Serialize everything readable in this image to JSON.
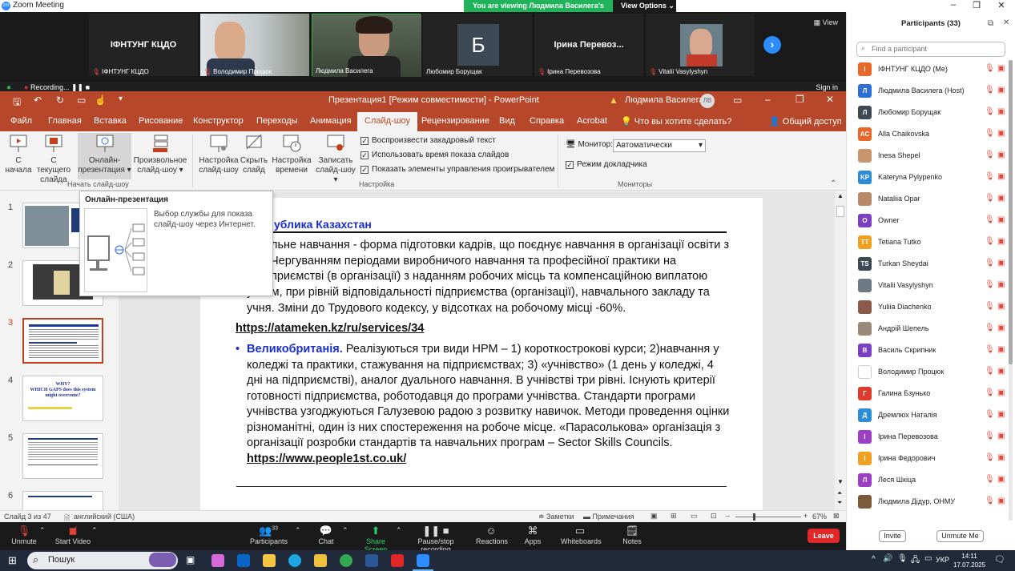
{
  "zoom_window": {
    "title": "Zoom Meeting",
    "banner": "You are viewing Людмила Василега's screen",
    "view_options": "View Options",
    "view_label": "View",
    "recording_label": "Recording...",
    "sign_in": "Sign in"
  },
  "video_tiles": [
    {
      "name": "ІФНТУНГ КЦДО",
      "display": "ІФНТУНГ КЦДО"
    },
    {
      "name": "Володимир Процюк",
      "display": ""
    },
    {
      "name": "Людмила Василега",
      "display": ""
    },
    {
      "name": "Любомир Борущак",
      "display": "Б"
    },
    {
      "name": "Ірина Перевозова",
      "display": "Ірина  Перевоз..."
    },
    {
      "name": "Vitalii Vasylyshyn",
      "display": ""
    }
  ],
  "ppt": {
    "title": "Презентация1 [Режим совместимости] - PowerPoint",
    "user": "Людмила Василега",
    "initials": "ЛВ",
    "tabs": [
      "Файл",
      "Главная",
      "Вставка",
      "Рисование",
      "Конструктор",
      "Переходы",
      "Анимация",
      "Слайд-шоу",
      "Рецензирование",
      "Вид",
      "Справка",
      "Acrobat"
    ],
    "tell_me": "Что вы хотите сделать?",
    "share": "Общий доступ",
    "ribbon": {
      "from_start": [
        "С",
        "начала"
      ],
      "from_current": [
        "С текущего",
        "слайда"
      ],
      "online": [
        "Онлайн-",
        "презентация"
      ],
      "custom": [
        "Произвольное",
        "слайд-шоу"
      ],
      "setup": [
        "Настройка",
        "слайд-шоу"
      ],
      "hide": [
        "Скрыть",
        "слайд"
      ],
      "timings": [
        "Настройка",
        "времени"
      ],
      "record": [
        "Записать",
        "слайд-шоу"
      ],
      "chk_narration": "Воспроизвести закадровый текст",
      "chk_timings": "Использовать время показа слайдов",
      "chk_controls": "Показать элементы управления проигрывателем",
      "monitor_label": "Монитор:",
      "monitor_value": "Автоматически",
      "presenter_view": "Режим докладчика",
      "group_start": "Начать слайд-шоу",
      "group_setup": "Настройка",
      "group_monitors": "Мониторы"
    },
    "tooltip": {
      "title": "Онлайн-презентация",
      "desc": "Выбор службы для показа слайд-шоу через Интернет."
    },
    "thumb_numbers": [
      "1",
      "2",
      "3",
      "4",
      "5",
      "6"
    ],
    "thumb4_text": [
      "WHY?",
      "WHICH GAPS does this system",
      "might   overcome?"
    ],
    "slide": {
      "heading_partial": "ублика Казахстан",
      "para1": [
        "льне навчання - форма підготовки кадрів, що поєднує навчання в організації освіти з",
        "Чергуванням періодами виробничого навчання та професійної практики на",
        "приємствi (в організації) з наданням робочих місць та компенсаційною виплатою",
        "учням, при рівній відповідальності підприємства (організації), навчального закладу та",
        "учня. Зміни до Трудового кодексу, у відсотках на робочому місці -60%."
      ],
      "link1": " https://atameken.kz/ru/services/34",
      "uk_label": "Великобританія.",
      "para2_first": " Реалізуються три види НРМ – 1) короткострокові курси; 2)навчання у",
      "para2": [
        "коледжі та практики, стажування на підприємствах; 3) «учнівство» (1 день у коледжі, 4",
        "дні на підприємстві), аналог дуального навчання. В учнівстві три рівні. Існують критерії",
        "готовності підприємства, роботодавця до програми учнівства. Стандарти програми",
        "учнівства узгоджуються Галузевою радою з розвитку навичок. Методи проведення оцінки",
        "різноманітні, один із них спостереження на робоче місце. «Парасолькова» організація з",
        "організації розробки стандартів та навчальних програм – Sector Skills Councils."
      ],
      "link2": "https://www.people1st.co.uk/"
    },
    "status": {
      "slide": "Слайд 3 из 47",
      "language": "английский (США)",
      "notes": "Заметки",
      "comments": "Примечания",
      "zoom": "67%"
    }
  },
  "zoom_toolbar": {
    "unmute": "Unmute",
    "start_video": "Start Video",
    "participants": "Participants",
    "participants_count": "33",
    "chat": "Chat",
    "share": "Share Screen",
    "pause_rec": "Pause/stop recording",
    "reactions": "Reactions",
    "apps": "Apps",
    "whiteboards": "Whiteboards",
    "notes": "Notes",
    "leave": "Leave"
  },
  "participants_panel": {
    "title": "Participants (33)",
    "search_placeholder": "Find a participant",
    "invite": "Invite",
    "unmute_me": "Unmute Me",
    "list": [
      {
        "name": "ІФНТУНГ КЦДО (Me)",
        "initial": "І",
        "color": "#e8682a"
      },
      {
        "name": "Людмила Василега (Host)",
        "initial": "Л",
        "color": "#2d6fd6"
      },
      {
        "name": "Любомир Борущак",
        "initial": "Л",
        "color": "#3d4a55"
      },
      {
        "name": "Alla Chaikovska",
        "initial": "AC",
        "color": "#e8682a"
      },
      {
        "name": "Inesa Shepel",
        "initial": "",
        "color": "#c9956b"
      },
      {
        "name": "Kateryna Pylypenko",
        "initial": "KP",
        "color": "#2d8cd6"
      },
      {
        "name": "Nataliia Opar",
        "initial": "",
        "color": "#b78a6a"
      },
      {
        "name": "Owner",
        "initial": "O",
        "color": "#7b3fc4"
      },
      {
        "name": "Tetiana Tutko",
        "initial": "TT",
        "color": "#f0a020"
      },
      {
        "name": "Turkan Sheydai",
        "initial": "TS",
        "color": "#3d4a55"
      },
      {
        "name": "Vitalii Vasylyshyn",
        "initial": "",
        "color": "#6d7a86"
      },
      {
        "name": "Yuliia Diachenko",
        "initial": "",
        "color": "#8a5a4a"
      },
      {
        "name": "Андрій Шепель",
        "initial": "",
        "color": "#9a8a7a"
      },
      {
        "name": "Василь Скрипник",
        "initial": "В",
        "color": "#7b3fc4"
      },
      {
        "name": "Володимир Процюк",
        "initial": "",
        "color": "#ffffff"
      },
      {
        "name": "Галина Бзунько",
        "initial": "Г",
        "color": "#e03a2a"
      },
      {
        "name": "Дремлюх Наталія",
        "initial": "Д",
        "color": "#2d8cd6"
      },
      {
        "name": "Ірина Перевозова",
        "initial": "І",
        "color": "#9b3fc4"
      },
      {
        "name": "Ірина Федорович",
        "initial": "І",
        "color": "#f0a020"
      },
      {
        "name": "Леся Шкіца",
        "initial": "Л",
        "color": "#9b3fc4"
      },
      {
        "name": "Людмила Дідур, ОНМУ",
        "initial": "",
        "color": "#7a5a3a"
      }
    ]
  },
  "taskbar": {
    "search": "Пошук",
    "lang": "УКР",
    "time": "14:11",
    "date": "17.07.2025"
  }
}
